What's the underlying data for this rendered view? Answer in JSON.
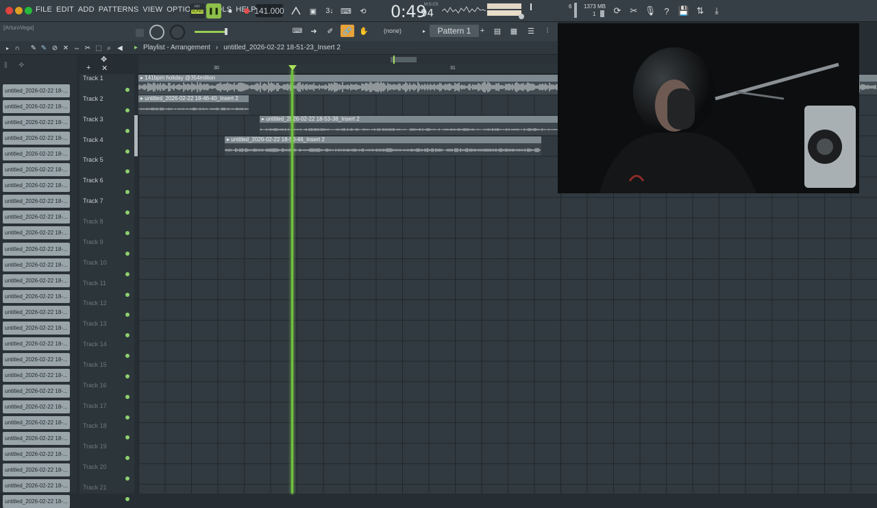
{
  "menu": [
    "FILE",
    "EDIT",
    "ADD",
    "PATTERNS",
    "VIEW",
    "OPTIONS",
    "TOOLS",
    "HELP"
  ],
  "transport": {
    "mode_label": "SONG",
    "mode_top": "PAT",
    "tempo": "141.000"
  },
  "time": {
    "main": "0:49",
    "sub": "94",
    "format": "M:S:CS"
  },
  "system": {
    "memory": "1373 MB",
    "cpu": "6",
    "poly": "1"
  },
  "hint_text": "[ArturoVega]",
  "pattern": {
    "name": "Pattern 1",
    "none_label": "(none)"
  },
  "breadcrumb": {
    "root": "Playlist - Arrangement",
    "item": "untitled_2026-02-22 18-51-23_Insert 2"
  },
  "ruler": {
    "marks": [
      "30",
      "31"
    ]
  },
  "channel_label": "untitled_2026-02-22 18-...",
  "channel_count": 27,
  "tracks": [
    "Track 1",
    "Track 2",
    "Track 3",
    "Track 4",
    "Track 5",
    "Track 6",
    "Track 7",
    "Track 8",
    "Track 9",
    "Track 10",
    "Track 11",
    "Track 12",
    "Track 13",
    "Track 14",
    "Track 15",
    "Track 16",
    "Track 17",
    "Track 18",
    "Track 19",
    "Track 20",
    "Track 21"
  ],
  "clips": [
    {
      "label": "141bpm holiday @354million",
      "track": 1
    },
    {
      "label": "untitled_2026-02-22 18-46-40_Insert 2",
      "track": 2
    },
    {
      "label": "untitled_2026-02-22 18-53-38_Insert 2",
      "track": 3
    },
    {
      "label": "untitled_2026-02-22 18-50-46_Insert 2",
      "track": 4
    }
  ],
  "colors": {
    "accent_green": "#6fc23a",
    "clip_header": "#7d888f",
    "background": "#262d33"
  }
}
